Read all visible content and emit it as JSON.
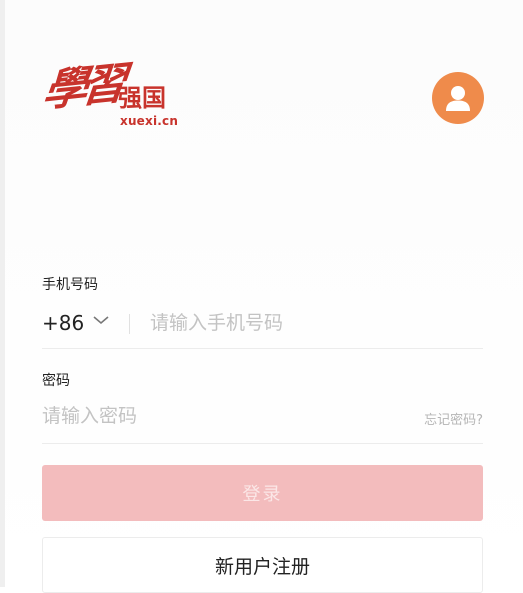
{
  "logo": {
    "calligraphy": "學習",
    "strong_text": "强国",
    "domain_text": "xuexi.cn"
  },
  "avatar": {
    "icon": "user-icon",
    "color": "#ef8b4b"
  },
  "phone": {
    "label": "手机号码",
    "country_code": "+86",
    "placeholder": "请输入手机号码",
    "value": ""
  },
  "password": {
    "label": "密码",
    "placeholder": "请输入密码",
    "value": "",
    "forgot_label": "忘记密码?"
  },
  "buttons": {
    "login_label": "登录",
    "register_label": "新用户注册"
  },
  "colors": {
    "brand_red": "#c8332c",
    "login_button_bg": "#f3bcbd",
    "avatar_orange": "#ef8b4b"
  }
}
